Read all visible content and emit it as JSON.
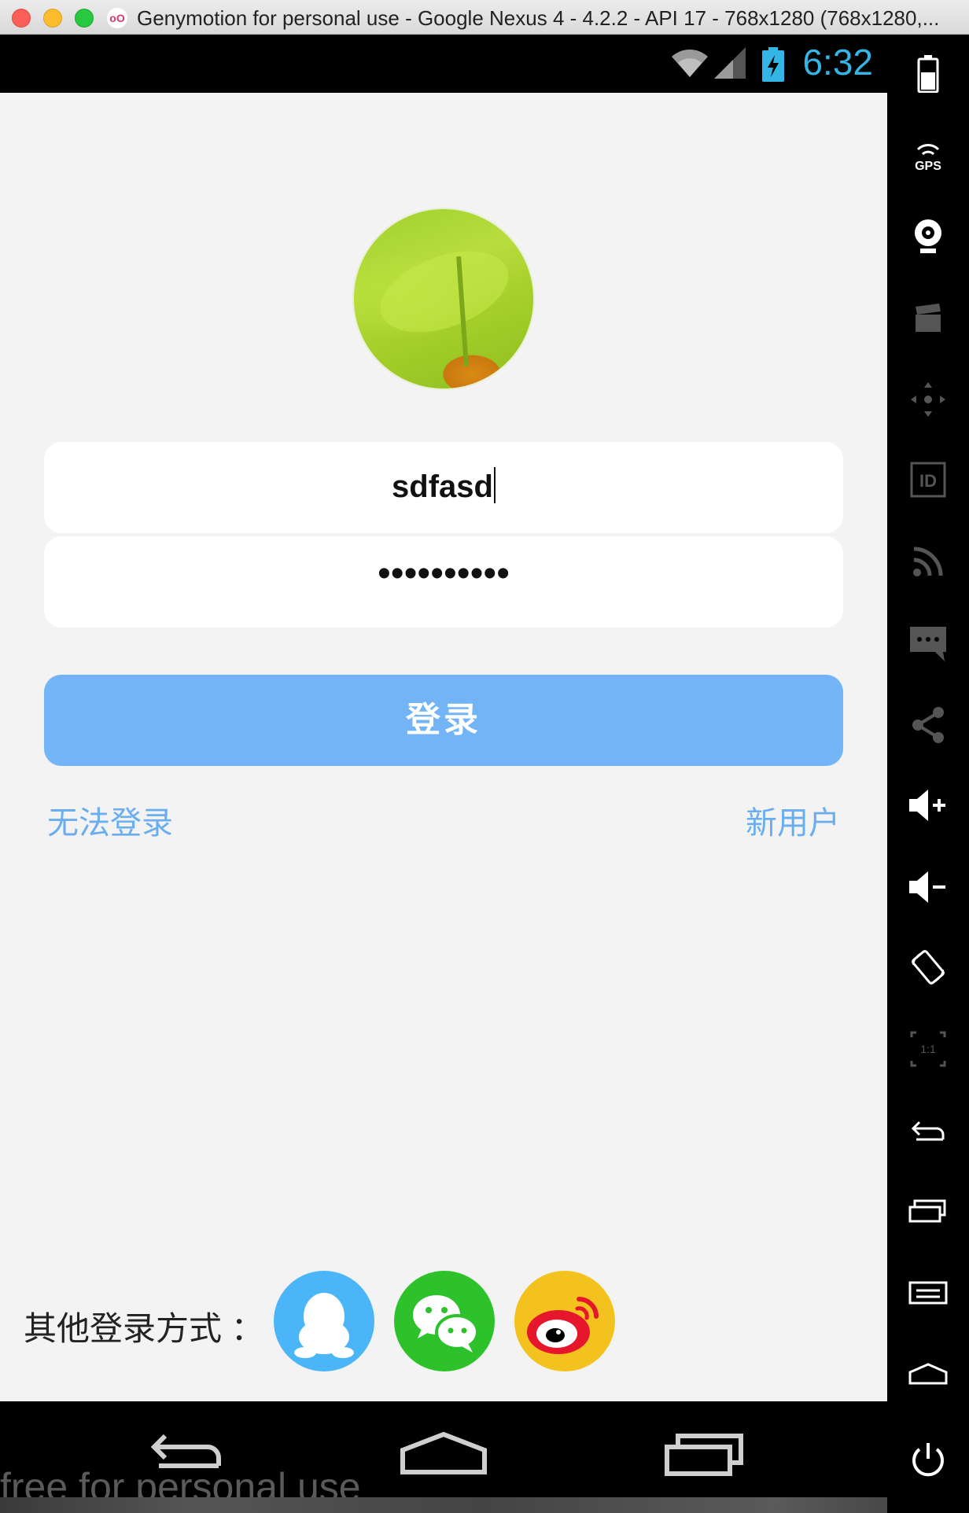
{
  "window": {
    "title": "Genymotion for personal use - Google Nexus 4 - 4.2.2 - API 17 - 768x1280 (768x1280,..."
  },
  "status_bar": {
    "time": "6:32"
  },
  "login": {
    "username_value": "sdfasd",
    "password_value": "••••••••••",
    "login_button": "登录",
    "forgot_link": "无法登录",
    "register_link": "新用户",
    "other_methods_label": "其他登录方式 ：",
    "social": [
      {
        "name": "QQ",
        "color": "#4ab5f7"
      },
      {
        "name": "WeChat",
        "color": "#2dc22c"
      },
      {
        "name": "Weibo",
        "color": "#f4c21f"
      }
    ]
  },
  "watermark": "free for personal use",
  "colors": {
    "accent": "#72b4f5",
    "link": "#6aaef0",
    "status_time": "#33b5e5"
  },
  "sidebar_icons": [
    "battery-icon",
    "gps-icon",
    "webcam-icon",
    "capture-icon",
    "dpad-icon",
    "id-icon",
    "network-icon",
    "sms-icon",
    "share-icon",
    "volume-up-icon",
    "volume-down-icon",
    "rotate-icon",
    "pixel-perfect-icon",
    "back-icon",
    "recent-apps-icon",
    "menu-icon",
    "home-icon",
    "power-icon"
  ]
}
